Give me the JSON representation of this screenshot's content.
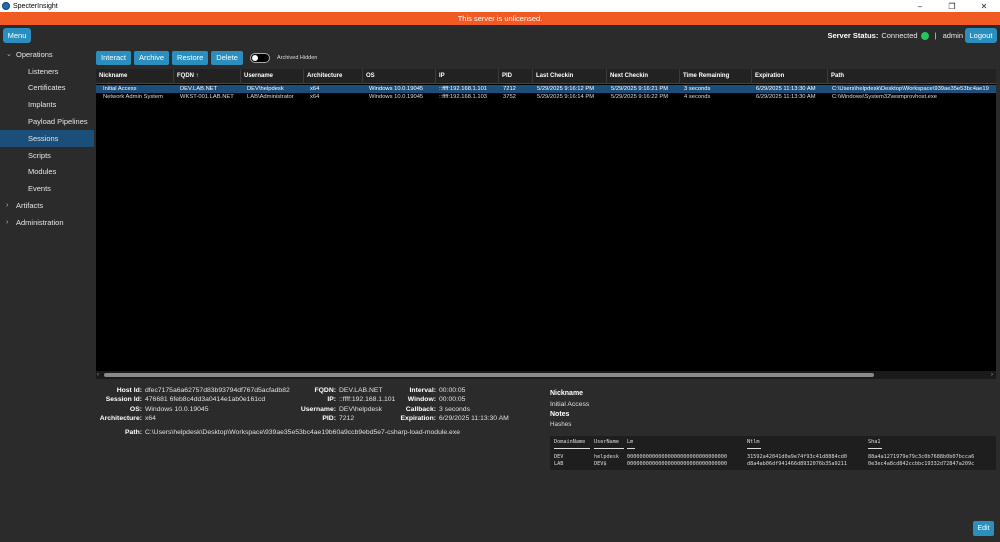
{
  "window": {
    "title": "SpecterInsight",
    "minimize": "–",
    "maximize": "❐",
    "close": "✕"
  },
  "banner": "This server is unlicensed.",
  "header": {
    "menu_label": "Menu",
    "server_status_label": "Server Status:",
    "server_status_value": "Connected",
    "separator": "|",
    "user": "admin",
    "logout_label": "Logout",
    "status_color": "#22c55e"
  },
  "sidebar": {
    "operations": "Operations",
    "items": [
      "Listeners",
      "Certificates",
      "Implants",
      "Payload Pipelines",
      "Sessions",
      "Scripts",
      "Modules",
      "Events"
    ],
    "active": "Sessions",
    "artifacts": "Artifacts",
    "administration": "Administration"
  },
  "toolbar": {
    "interact": "Interact",
    "archive": "Archive",
    "restore": "Restore",
    "delete": "Delete",
    "archived_hidden": "Archived Hidden"
  },
  "table": {
    "columns": [
      "Nickname",
      "FQDN ↑",
      "Username",
      "Architecture",
      "OS",
      "IP",
      "PID",
      "Last Checkin",
      "Next Checkin",
      "Time Remaining",
      "Expiration",
      "Path"
    ],
    "rows": [
      [
        "Initial Access",
        "DEV.LAB.NET",
        "DEV\\helpdesk",
        "x64",
        "Windows 10.0.19045",
        "::ffff:192.168.1.101",
        "7212",
        "5/29/2025 9:16:12 PM",
        "5/29/2025 9:16:21 PM",
        "3 seconds",
        "6/29/2025 11:13:30 AM",
        "C:\\Users\\helpdesk\\Desktop\\Workspace\\939ae35e53bc4ae19"
      ],
      [
        "Network Admin System",
        "WKST-001.LAB.NET",
        "LAB\\Administrator",
        "x64",
        "Windows 10.0.19045",
        "::ffff:192.168.1.103",
        "3752",
        "5/29/2025 9:16:14 PM",
        "5/29/2025 9:16:22 PM",
        "4 seconds",
        "6/29/2025 11:13:30 AM",
        "C:\\Windows\\System32\\wsmprovhost.exe"
      ]
    ]
  },
  "details": {
    "col1": [
      {
        "k": "Host Id:",
        "v": "dfec7175a6a62757d83b93794df767d5acfadb82"
      },
      {
        "k": "Session Id:",
        "v": "476681 6feb8c4dd3a0414e1ab0e161cd"
      },
      {
        "k": "OS:",
        "v": "Windows 10.0.19045"
      },
      {
        "k": "Architecture:",
        "v": "x64"
      }
    ],
    "col2": [
      {
        "k": "FQDN:",
        "v": "DEV.LAB.NET"
      },
      {
        "k": "IP:",
        "v": "::ffff:192.168.1.101"
      },
      {
        "k": "Username:",
        "v": "DEV\\helpdesk"
      },
      {
        "k": "PID:",
        "v": "7212"
      }
    ],
    "col3": [
      {
        "k": "Interval:",
        "v": "00:00:05"
      },
      {
        "k": "Window:",
        "v": "00:00:05"
      },
      {
        "k": "Callback:",
        "v": "3 seconds"
      },
      {
        "k": "Expiration:",
        "v": "6/29/2025 11:13:30 AM"
      }
    ],
    "path_label": "Path:",
    "path_value": "C:\\Users\\helpdesk\\Desktop\\Workspace\\939ae35e53bc4ae19b60a9ccb9ebd5e7-csharp-load-module.exe"
  },
  "info": {
    "nickname_label": "Nickname",
    "nickname_value": "Initial Access",
    "notes_label": "Notes",
    "notes_value": "Hashes",
    "hash_headers": [
      "DomainName",
      "UserName",
      "Lm",
      "Ntlm",
      "Sha1"
    ],
    "hash_rows": [
      [
        "DEV",
        "helpdesk",
        "00000000000000000000000000000000",
        "31592a42041d0a9e74f93c41d8884cd0",
        "88a4a1271979e79c3c0b7688b0b07bcca6"
      ],
      [
        "LAB",
        "DEV$",
        "00000000000000000000000000000000",
        "d8a4ab06df941466d8932076b35a9211",
        "0e3ec4a8cd842ccbbc19332d72847a209c"
      ]
    ]
  },
  "edit_label": "Edit"
}
